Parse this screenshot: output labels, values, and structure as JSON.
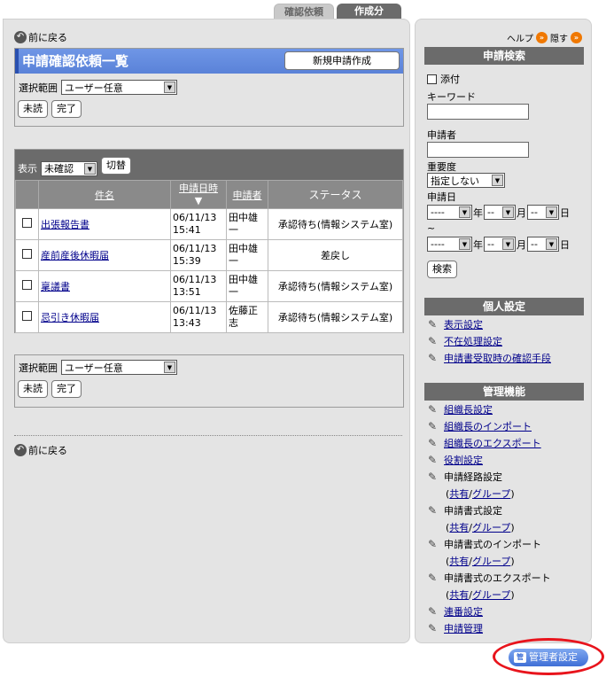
{
  "tabs": [
    {
      "label": "確認依頼",
      "active": false
    },
    {
      "label": "作成分",
      "active": true
    }
  ],
  "main": {
    "back_label": "前に戻る",
    "title": "申請確認依頼一覧",
    "new_button": "新規申請作成",
    "scope_label": "選択範囲",
    "scope_value": "ユーザー任意",
    "unread_btn": "未読",
    "done_btn": "完了",
    "display_label": "表示",
    "display_value": "未確認",
    "switch_btn": "切替",
    "columns": [
      "件名",
      "申請日時",
      "申請者",
      "ステータス"
    ],
    "sort_marker": "▼",
    "rows": [
      {
        "subject": "出張報告書",
        "date": "06/11/13",
        "time": "15:41",
        "applicant": "田中雄一",
        "status": "承認待ち(情報システム室)"
      },
      {
        "subject": "産前産後休暇届",
        "date": "06/11/13",
        "time": "15:39",
        "applicant": "田中雄一",
        "status": "差戻し"
      },
      {
        "subject": "稟議書",
        "date": "06/11/13",
        "time": "13:51",
        "applicant": "田中雄一",
        "status": "承認待ち(情報システム室)"
      },
      {
        "subject": "忌引き休暇届",
        "date": "06/11/13",
        "time": "13:43",
        "applicant": "佐藤正志",
        "status": "承認待ち(情報システム室)"
      }
    ],
    "bottom_back_label": "前に戻る"
  },
  "side": {
    "help": "ヘルプ",
    "hide": "隠す",
    "search_head": "申請検索",
    "attach_label": "添付",
    "keyword_label": "キーワード",
    "applicant_label": "申請者",
    "priority_label": "重要度",
    "priority_value": "指定しない",
    "date_label": "申請日",
    "dash": "----",
    "year": "年",
    "month": "月",
    "day": "日",
    "tilde": "~",
    "search_btn": "検索",
    "personal_head": "個人設定",
    "personal_items": [
      "表示設定",
      "不在処理設定",
      "申請書受取時の確認手段"
    ],
    "admin_head": "管理機能",
    "admin_items": [
      "組織長設定",
      "組織長のインポート",
      "組織長のエクスポート",
      "役割設定"
    ],
    "route_setting": "申請経路設定",
    "form_setting": "申請書式設定",
    "form_import": "申請書式のインポート",
    "form_export": "申請書式のエクスポート",
    "shared": "共有",
    "group": "グループ",
    "serial_setting": "連番設定",
    "request_mgmt": "申請管理"
  },
  "admin_settings_button": "管理者設定",
  "colors": {
    "accent": "#5a82d8",
    "highlight": "#e8141c",
    "header_gray": "#6b6b6b"
  }
}
